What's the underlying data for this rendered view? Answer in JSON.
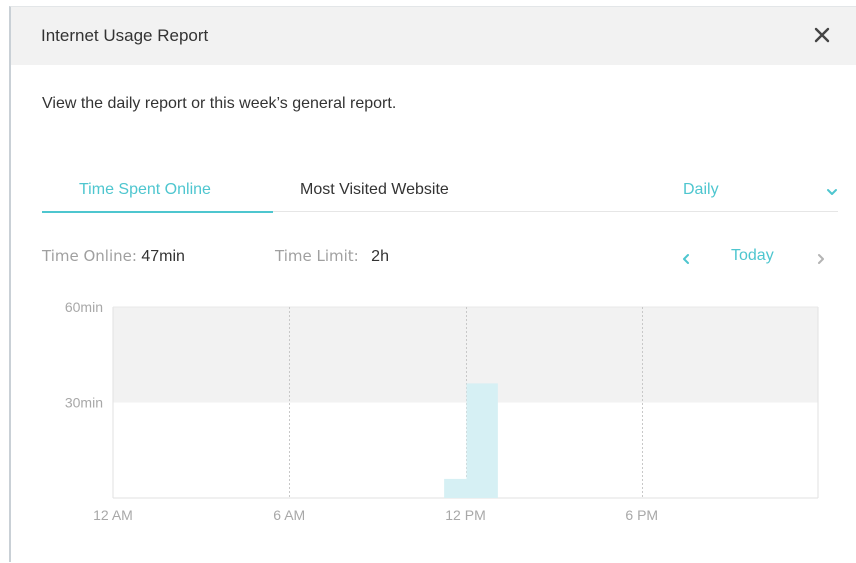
{
  "dialog": {
    "title": "Internet Usage Report",
    "close_icon": "close-icon",
    "subtitle": "View the daily report or this week’s general report."
  },
  "tabs": [
    {
      "label": "Time Spent Online",
      "active": true
    },
    {
      "label": "Most Visited Website",
      "active": false
    }
  ],
  "period": {
    "selected": "Daily",
    "icon": "chevron-down-icon"
  },
  "stats": {
    "time_online_label": "Time Online:",
    "time_online_value": "47min",
    "time_limit_label": "Time Limit:",
    "time_limit_value": "2h"
  },
  "navigation": {
    "prev_icon": "chevron-left-icon",
    "current": "Today",
    "next_icon": "chevron-right-icon"
  },
  "colors": {
    "accent": "#4ec6cf",
    "bar": "#d6f0f4",
    "limit_band": "#f2f2f2"
  },
  "chart_data": {
    "type": "bar",
    "x_range_hours": [
      0,
      24
    ],
    "x_ticks": [
      {
        "hour": 0,
        "label": "12 AM"
      },
      {
        "hour": 6,
        "label": "6 AM"
      },
      {
        "hour": 12,
        "label": "12 PM"
      },
      {
        "hour": 18,
        "label": "6 PM"
      }
    ],
    "ylim": [
      0,
      60
    ],
    "y_ticks": [
      {
        "value": 60,
        "label": "60min"
      },
      {
        "value": 30,
        "label": "30min"
      }
    ],
    "shaded_band": [
      30,
      60
    ],
    "bars": [
      {
        "hour": 11,
        "value": 6
      },
      {
        "hour": 12,
        "value": 36
      }
    ]
  }
}
